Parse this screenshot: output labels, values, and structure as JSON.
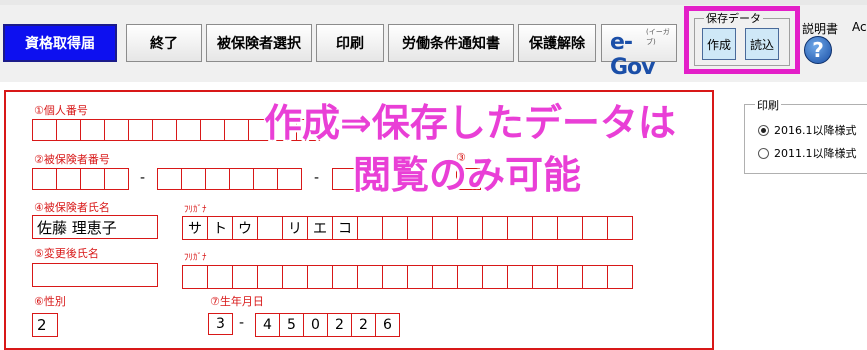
{
  "toolbar": {
    "primary_label": "資格取得届",
    "exit_label": "終了",
    "select_insured_label": "被保険者選択",
    "print_label": "印刷",
    "labor_notice_label": "労働条件通知書",
    "protect_release_label": "保護解除",
    "egov_label": "e-Gov",
    "egov_sub": "(イーガブ)",
    "help_label": "説明書",
    "help_icon_text": "?",
    "cutoff_text": "Ac"
  },
  "save_data": {
    "legend": "保存データ",
    "create_label": "作成",
    "load_label": "読込"
  },
  "form": {
    "personal_number_label": "①個人番号",
    "insured_number_label": "②被保険者番号",
    "insured_name_label": "④被保険者氏名",
    "insured_name_value": "佐藤  理恵子",
    "furigana_label": "ﾌﾘｶﾞﾅ",
    "furigana_cells": [
      "サ",
      "ト",
      "ウ",
      "",
      "リ",
      "エ",
      "コ",
      "",
      "",
      "",
      "",
      "",
      "",
      "",
      "",
      "",
      "",
      ""
    ],
    "changed_name_label": "⑤変更後氏名",
    "changed_furigana_label": "ﾌﾘｶﾞﾅ",
    "gender_label": "⑥性別",
    "gender_value": "2",
    "birth_label": "⑦生年月日",
    "birth_era": "3",
    "birth_digits": [
      "4",
      "5",
      "0",
      "2",
      "2",
      "6"
    ],
    "partial_label": "③",
    "dash": "-"
  },
  "overlay": {
    "line1": "作成⇒保存したデータは",
    "line2": "閲覧のみ可能"
  },
  "print_panel": {
    "legend": "印刷",
    "options": [
      {
        "label": "2016.1以降様式",
        "selected": true
      },
      {
        "label": "2011.1以降様式",
        "selected": false
      }
    ]
  },
  "colors": {
    "accent_magenta": "#e31fc8",
    "form_red": "#d81818",
    "primary_blue": "#0d10f0"
  }
}
